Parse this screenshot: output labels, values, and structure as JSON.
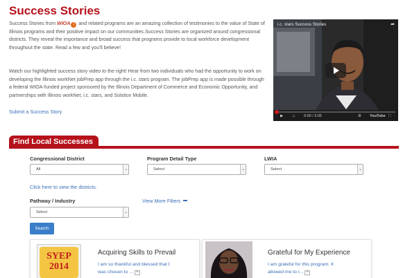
{
  "page": {
    "title": "Success Stories",
    "intro_part1": "Success Stories from",
    "intro_wioa": "WIOA",
    "intro_info_glyph": "i",
    "intro_part2": "and related programs are an amazing collection of testimonies to the value of State of Illinois programs and their positive impact on our communities.Success Stories are organized around congressional districts. They reveal the importance and broad success that programs provide to local workforce development throughout the state. Read a few and you'll believe!",
    "intro_video_paragraph": "Watch our highlighted success story video to the right! Hear from two individuals who had the opportunity to work on developing the Illinois workNet jobPrep app through the i.c. stars program. The jobPrep app is made possible through a federal WIOA-funded project sponsored by the Illinois Department of Commerce and Economic Opportunity, and partnerships with Illinois workNet, i.c. stars, and Solstice Mobile.",
    "submit_link": "Submit a Success Story"
  },
  "video": {
    "title": "i.c. stars Success Stories",
    "share_icon": "share-icon",
    "time": "0:00 / 3:05",
    "youtube_label": "YouTube",
    "progress": 0.02
  },
  "find": {
    "heading": "Find Local Successes",
    "congressional_label": "Congressional District",
    "congressional_value": "All",
    "program_label": "Program Detail Type",
    "program_value": "Select",
    "lwia_label": "LWIA",
    "lwia_value": "Select",
    "districts_link": "Click here to view the districts.",
    "pathway_label": "Pathway / Industry",
    "pathway_value": "Select",
    "more_filters": "View More Filters",
    "search_button": "Search"
  },
  "cards": [
    {
      "title": "Acquiring Skills to Prevail",
      "snippet_line1": "I am so thankful and blessed that I",
      "snippet_line2": "was chosen to ...",
      "thumb_line1": "SYEP",
      "thumb_line2": "2014"
    },
    {
      "title": "Grateful for My Experience",
      "snippet_line1": "I am grateful for this program. It",
      "snippet_line2": "allowed me to r..."
    }
  ],
  "colors": {
    "brand_red": "#b5121b",
    "link_blue": "#3a6fb5",
    "button_blue": "#3a7dc9"
  }
}
